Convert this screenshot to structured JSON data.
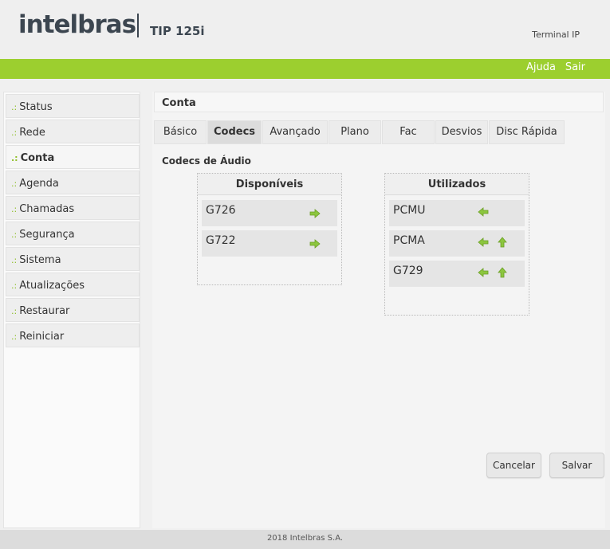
{
  "header": {
    "brand": "intelbras",
    "model": "TIP 125i",
    "title": "Terminal IP"
  },
  "topbar": {
    "help": "Ajuda",
    "exit": "Sair",
    "color": "#9ccf2f"
  },
  "sidebar": {
    "bullet": ".:",
    "items": [
      {
        "label": "Status"
      },
      {
        "label": "Rede"
      },
      {
        "label": "Conta",
        "active": true
      },
      {
        "label": "Agenda"
      },
      {
        "label": "Chamadas"
      },
      {
        "label": "Segurança"
      },
      {
        "label": "Sistema"
      },
      {
        "label": "Atualizações"
      },
      {
        "label": "Restaurar"
      },
      {
        "label": "Reiniciar"
      }
    ]
  },
  "main": {
    "section_title": "Conta",
    "tabs": [
      {
        "label": "Básico"
      },
      {
        "label": "Codecs",
        "active": true
      },
      {
        "label": "Avançado"
      },
      {
        "label": "Plano"
      },
      {
        "label": "Fac"
      },
      {
        "label": "Desvios"
      },
      {
        "label": "Disc Rápida"
      }
    ],
    "audio_title": "Codecs de Áudio",
    "available": {
      "title": "Disponíveis",
      "items": [
        "G726",
        "G722"
      ]
    },
    "used": {
      "title": "Utilizados",
      "items": [
        "PCMU",
        "PCMA",
        "G729"
      ]
    },
    "buttons": {
      "cancel": "Cancelar",
      "save": "Salvar"
    }
  },
  "footer": {
    "text": "2018 Intelbras S.A."
  },
  "icons": {
    "arrow_right": "arrow-right-icon",
    "arrow_left": "arrow-left-icon",
    "arrow_up": "arrow-up-icon",
    "icon_color": "#8cc63f"
  }
}
